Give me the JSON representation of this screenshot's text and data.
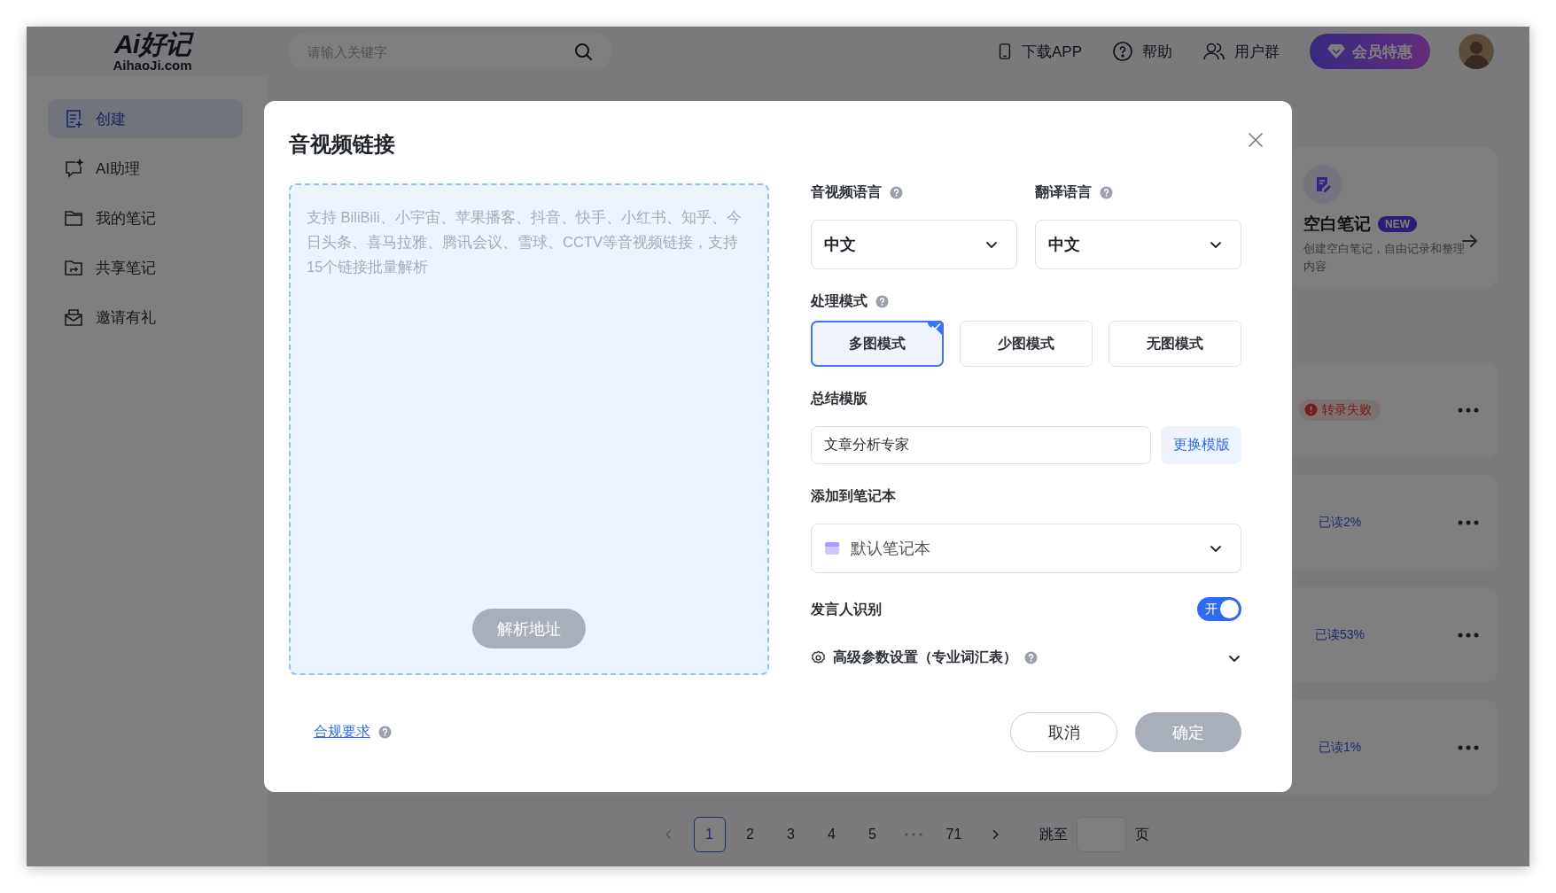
{
  "logo": {
    "mark": "Ai好记",
    "domain": "AihaoJi.com"
  },
  "search": {
    "placeholder": "请输入关键字"
  },
  "header_links": [
    {
      "label": "下载APP",
      "kind": "phone"
    },
    {
      "label": "帮助",
      "kind": "help"
    },
    {
      "label": "用户群",
      "kind": "users"
    }
  ],
  "vip_button": "会员特惠",
  "sidebar": {
    "items": [
      {
        "label": "创建",
        "kind": "create",
        "selected": true
      },
      {
        "label": "AI助理",
        "kind": "assistant",
        "selected": false
      },
      {
        "label": "我的笔记",
        "kind": "folder",
        "selected": false
      },
      {
        "label": "共享笔记",
        "kind": "shared",
        "selected": false
      },
      {
        "label": "邀请有礼",
        "kind": "invite",
        "selected": false
      }
    ]
  },
  "template_card": {
    "title": "空白笔记",
    "badge": "NEW",
    "description": "创建空白笔记，自由记录和整理内容"
  },
  "notes": [
    {
      "status": "转录失败",
      "kind": "failed"
    },
    {
      "status": "已读2%",
      "kind": "read"
    },
    {
      "status": "已读53%",
      "kind": "read"
    },
    {
      "status": "已读1%",
      "kind": "read"
    }
  ],
  "pagination": {
    "pages": [
      {
        "kind": "prev"
      },
      {
        "kind": "page",
        "label": "1",
        "selected": true
      },
      {
        "kind": "page",
        "label": "2",
        "selected": false
      },
      {
        "kind": "page",
        "label": "3",
        "selected": false
      },
      {
        "kind": "page",
        "label": "4",
        "selected": false
      },
      {
        "kind": "page",
        "label": "5",
        "selected": false
      },
      {
        "kind": "ellipsis"
      },
      {
        "kind": "page",
        "label": "71",
        "selected": false
      },
      {
        "kind": "next"
      }
    ],
    "jump_label": "跳至",
    "jump_suffix": "页"
  },
  "dialog": {
    "title": "音视频链接",
    "link_input": {
      "placeholder": "支持 BiliBili、小宇宙、苹果播客、抖音、快手、小红书、知乎、今日头条、喜马拉雅、腾讯会议、雪球、CCTV等音视频链接，支持15个链接批量解析"
    },
    "parse_button": {
      "label": "解析地址",
      "disabled": true
    },
    "media_language": {
      "label": "音视频语言",
      "value": "中文"
    },
    "translate_language": {
      "label": "翻译语言",
      "value": "中文"
    },
    "mode": {
      "label": "处理模式",
      "options": [
        {
          "label": "多图模式",
          "selected": true
        },
        {
          "label": "少图模式",
          "selected": false
        },
        {
          "label": "无图模式",
          "selected": false
        }
      ]
    },
    "template": {
      "label": "总结模版",
      "value": "文章分析专家",
      "button": "更换模版"
    },
    "notebook": {
      "label": "添加到笔记本",
      "value": "默认笔记本"
    },
    "speaker": {
      "label": "发言人识别",
      "on": true,
      "on_label": "开"
    },
    "advanced": {
      "label": "高级参数设置（专业词汇表）",
      "expanded": false
    },
    "compliance_link": "合规要求",
    "cancel_button": "取消",
    "confirm_button": {
      "label": "确定",
      "disabled": true
    }
  }
}
